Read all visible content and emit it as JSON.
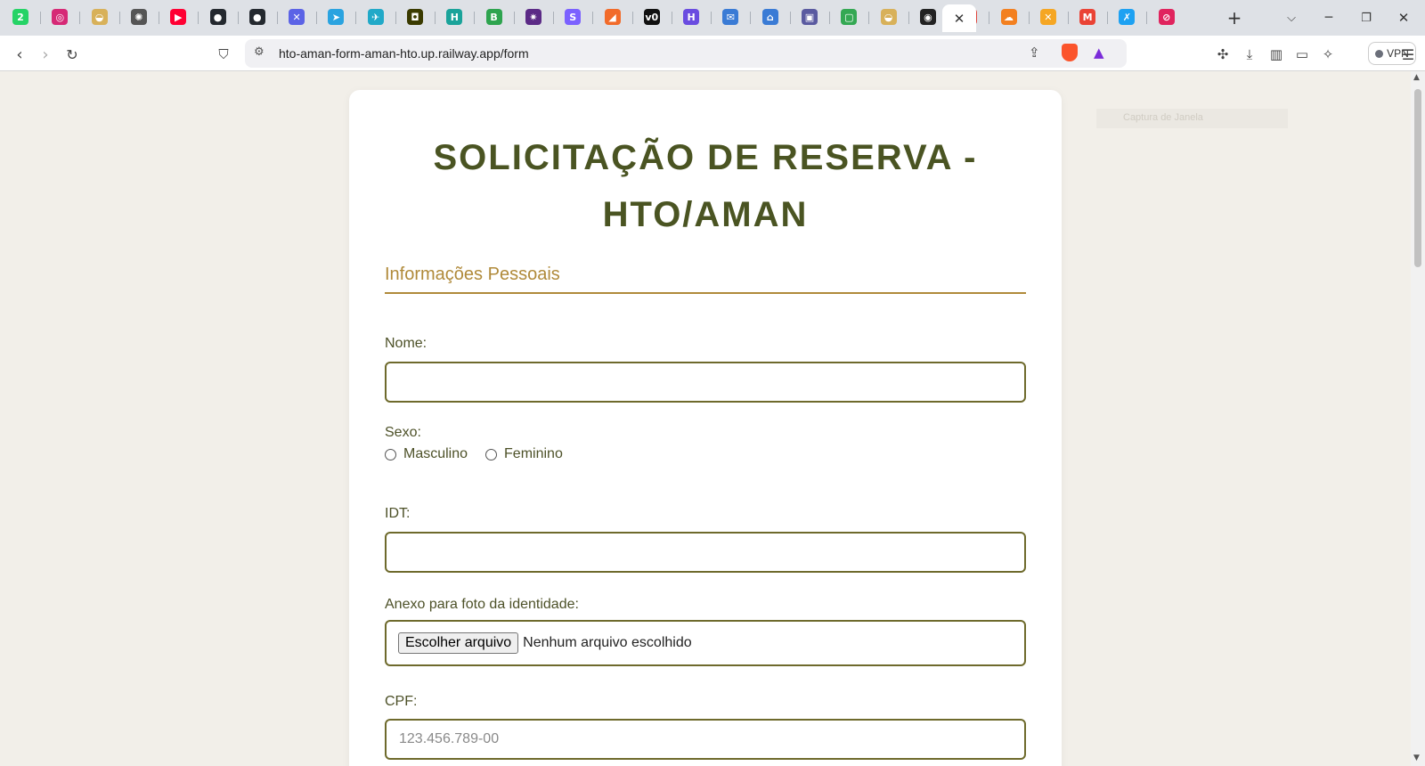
{
  "browser": {
    "url": "hto-aman-form-aman-hto.up.railway.app/form",
    "vpn_label": "VPN",
    "tab_icons": [
      {
        "name": "whatsapp-tab-icon",
        "glyph": "2",
        "color": "#25d366"
      },
      {
        "name": "instagram-tab-icon",
        "glyph": "◎",
        "color": "#d62976"
      },
      {
        "name": "food-tab-icon",
        "glyph": "◒",
        "color": "#d8b15a"
      },
      {
        "name": "openai-tab-icon",
        "glyph": "✺",
        "color": "#555555"
      },
      {
        "name": "youtube-tab-icon",
        "glyph": "▶",
        "color": "#ff0033"
      },
      {
        "name": "github-tab-icon",
        "glyph": "●",
        "color": "#24292f"
      },
      {
        "name": "github-tab-icon-2",
        "glyph": "●",
        "color": "#24292f"
      },
      {
        "name": "tools-tab-icon",
        "glyph": "✕",
        "color": "#5b63e6"
      },
      {
        "name": "telegram-tab-icon",
        "glyph": "➤",
        "color": "#2aa3e0"
      },
      {
        "name": "plane-tab-icon",
        "glyph": "✈",
        "color": "#21a9c8"
      },
      {
        "name": "app-tab-icon",
        "glyph": "◘",
        "color": "#3a3a00"
      },
      {
        "name": "h-tab-icon",
        "glyph": "H",
        "color": "#1aa39a"
      },
      {
        "name": "b-tab-icon",
        "glyph": "B",
        "color": "#2ea44f"
      },
      {
        "name": "star-tab-icon",
        "glyph": "✷",
        "color": "#5b2a86"
      },
      {
        "name": "s-tab-icon",
        "glyph": "S",
        "color": "#7b61ff"
      },
      {
        "name": "pen-tab-icon",
        "glyph": "◢",
        "color": "#f26b2a"
      },
      {
        "name": "v0-tab-icon",
        "glyph": "v0",
        "color": "#111111"
      },
      {
        "name": "h-purple-tab-icon",
        "glyph": "H",
        "color": "#6a4ce0"
      },
      {
        "name": "mail-tab-icon",
        "glyph": "✉",
        "color": "#3a7bd5"
      },
      {
        "name": "home-tab-icon",
        "glyph": "⌂",
        "color": "#3a7bd5"
      },
      {
        "name": "box-tab-icon",
        "glyph": "▣",
        "color": "#5a5aa0"
      },
      {
        "name": "google-tab-icon",
        "glyph": "▢",
        "color": "#34a853"
      },
      {
        "name": "food-tab-icon-2",
        "glyph": "◒",
        "color": "#d8b15a"
      },
      {
        "name": "dark-tab-icon",
        "glyph": "◉",
        "color": "#222222"
      },
      {
        "name": "lock-tab-icon",
        "glyph": "🔒",
        "color": "#e0433a"
      },
      {
        "name": "cloudflare-tab-icon",
        "glyph": "☁",
        "color": "#f38020"
      },
      {
        "name": "x-tab-icon",
        "glyph": "✕",
        "color": "#f5a623"
      },
      {
        "name": "gmail-tab-icon",
        "glyph": "M",
        "color": "#ea4335"
      },
      {
        "name": "x-blue-tab-icon",
        "glyph": "✗",
        "color": "#1da1f2"
      },
      {
        "name": "red-tab-icon",
        "glyph": "⊘",
        "color": "#e0245e"
      }
    ]
  },
  "page": {
    "title": "SOLICITAÇÃO DE RESERVA - HTO/AMAN",
    "section_title": "Informações Pessoais",
    "ghost_text": "Captura de Janela",
    "fields": {
      "nome_label": "Nome:",
      "nome_value": "",
      "sexo_label": "Sexo:",
      "sexo_options": [
        "Masculino",
        "Feminino"
      ],
      "idt_label": "IDT:",
      "idt_value": "",
      "anexo_label": "Anexo para foto da identidade:",
      "file_button": "Escolher arquivo",
      "file_status": "Nenhum arquivo escolhido",
      "cpf_label": "CPF:",
      "cpf_placeholder": "123.456.789-00"
    }
  },
  "colors": {
    "title": "#4a5422",
    "section": "#b08a3a",
    "field_border": "#6e6a2c",
    "page_bg": "#f2efe9"
  }
}
